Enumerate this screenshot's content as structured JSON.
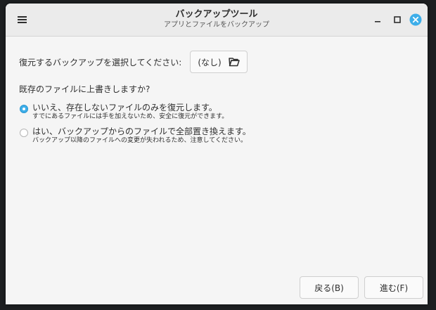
{
  "window": {
    "title": "バックアップツール",
    "subtitle": "アプリとファイルをバックアップ"
  },
  "select_row": {
    "label": "復元するバックアップを選択してください:",
    "file_button_label": "(なし)"
  },
  "question": "既存のファイルに上書きしますか?",
  "options": [
    {
      "label": "いいえ、存在しないファイルのみを復元します。",
      "description": "すでにあるファイルには手を加えないため、安全に復元ができます。",
      "checked": true
    },
    {
      "label": "はい、バックアップからのファイルで全部置き換えます。",
      "description": "バックアップ以降のファイルへの変更が失われるため、注意してください。",
      "checked": false
    }
  ],
  "buttons": {
    "back": "戻る(B)",
    "next": "進む(F)"
  },
  "colors": {
    "accent": "#3daee9",
    "close": "#3daee9"
  }
}
